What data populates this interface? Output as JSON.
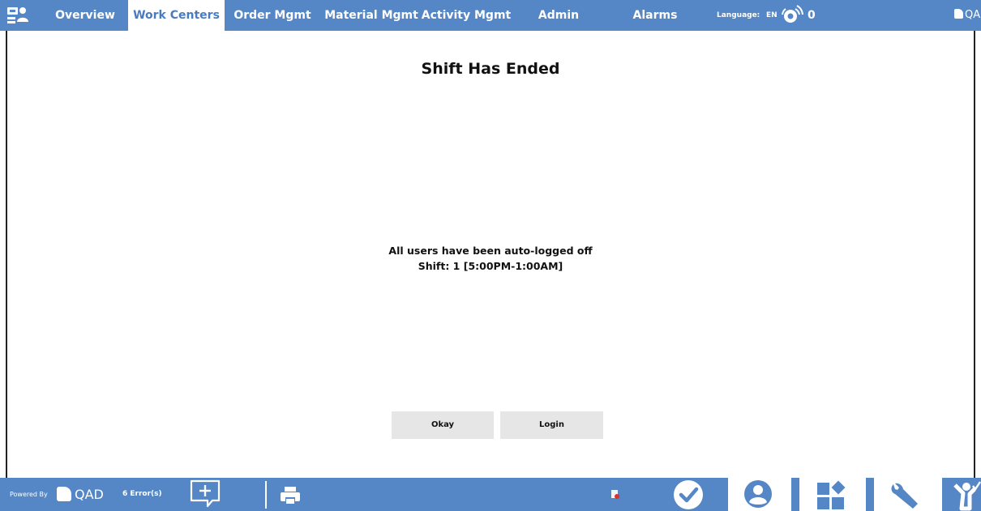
{
  "nav": {
    "tabs": [
      {
        "label": "Overview"
      },
      {
        "label": "Work Centers",
        "active": true
      },
      {
        "label": "Order Mgmt"
      },
      {
        "label": "Material Mgmt"
      },
      {
        "label": "Activity Mgmt"
      },
      {
        "label": "Admin"
      },
      {
        "label": "Alarms"
      }
    ],
    "language_label": "Language:",
    "language_value": "EN",
    "alarm_count": "0",
    "brand": "QAD",
    "app_icon": "workstation-user-icon",
    "alarm_icon": "broadcast-alarm-icon"
  },
  "dialog": {
    "title": "Shift Has Ended",
    "message_line1": "All users have been auto-logged off",
    "message_line2": "Shift: 1 [5:00PM-1:00AM]",
    "okay_label": "Okay",
    "login_label": "Login"
  },
  "footer": {
    "powered_by": "Powered By",
    "brand": "QAD",
    "errors": "6 Error(s)",
    "icons": [
      "add-comment-icon",
      "print-icon",
      "status-document-icon",
      "check-icon",
      "user-icon",
      "dashboard-icon",
      "wrench-icon",
      "operator-icon"
    ]
  },
  "colors": {
    "bar": "#5586c5",
    "active_tab_text": "#4a7bbf",
    "button_bg": "#e6e6e6"
  }
}
